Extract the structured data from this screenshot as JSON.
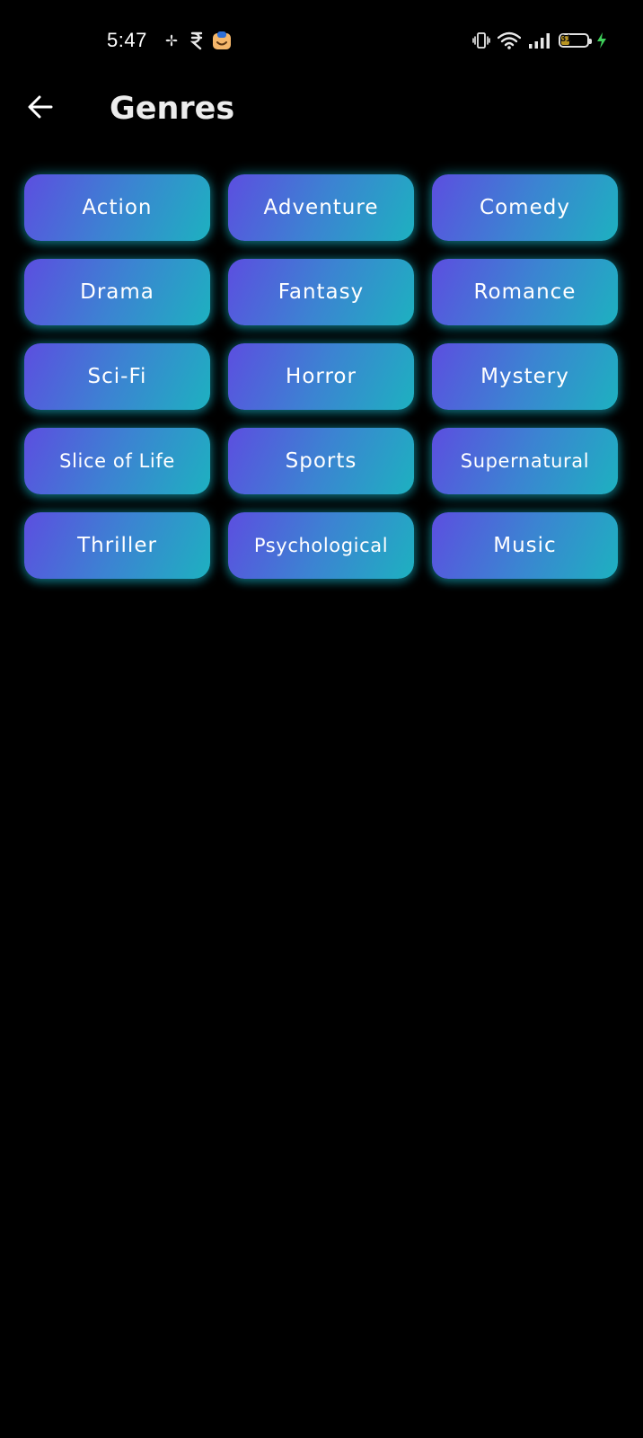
{
  "status_bar": {
    "time": "5:47",
    "battery_level": "31",
    "battery_fraction": 0.31,
    "notification_icons": [
      "pinwheel-icon",
      "rupee-icon",
      "shopping-bag-icon"
    ],
    "system_icons": [
      "vibrate-icon",
      "wifi-icon",
      "signal-icon",
      "battery-icon",
      "charging-icon"
    ]
  },
  "header": {
    "title": "Genres",
    "back_icon": "arrow-left-icon"
  },
  "genres": [
    "Action",
    "Adventure",
    "Comedy",
    "Drama",
    "Fantasy",
    "Romance",
    "Sci-Fi",
    "Horror",
    "Mystery",
    "Slice of Life",
    "Sports",
    "Supernatural",
    "Thriller",
    "Psychological",
    "Music"
  ],
  "colors": {
    "background": "#000000",
    "chip_gradient_start": "#5c4ee0",
    "chip_gradient_end": "#1db1c0",
    "chip_glow": "#19b4c8",
    "title_text": "#ececec",
    "charging": "#3ecf5a"
  }
}
